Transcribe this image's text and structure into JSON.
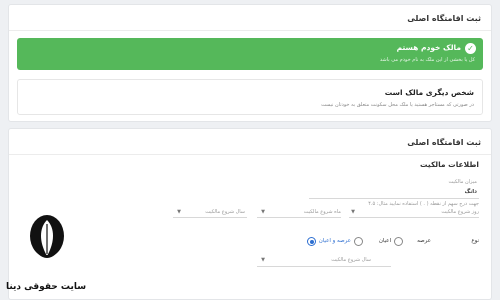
{
  "card1": {
    "title": "ثبت اقامتگاه اصلی",
    "owner_option": {
      "title": "مالک خودم هستم",
      "subtitle": "کل یا بخشی از این ملک به نام خودم می باشد"
    },
    "other_option": {
      "title": "شخص دیگری مالک است",
      "subtitle": "در صورتی که مستاجر هستید یا ملک محل سکونت متعلق به خودتان نیست"
    }
  },
  "card2": {
    "title": "ثبت اقامتگاه اصلی",
    "section_title": "اطلاعات مالکیت",
    "share_label": "میزان مالکیت",
    "share_unit": "دانگ",
    "share_hint": "جهت درج سهم از نقطه ( . ) استفاده نمایید مثال: ۴.۵",
    "field_start_date": "روز شروع مالکیت",
    "field_start_month": "ماه شروع مالکیت",
    "field_start_year": "سال شروع مالکیت",
    "ownership_type_label": "نوع",
    "radio_arseh": "عرصه",
    "radio_ayan": "اعیان",
    "radio_both": "عرصه و اعیان",
    "field_year_2": "سال شروع مالکیت"
  },
  "watermark": {
    "text": "سایت حقوقی دینا"
  },
  "colors": {
    "green": "#55b85a",
    "blue": "#2e6fd1"
  }
}
